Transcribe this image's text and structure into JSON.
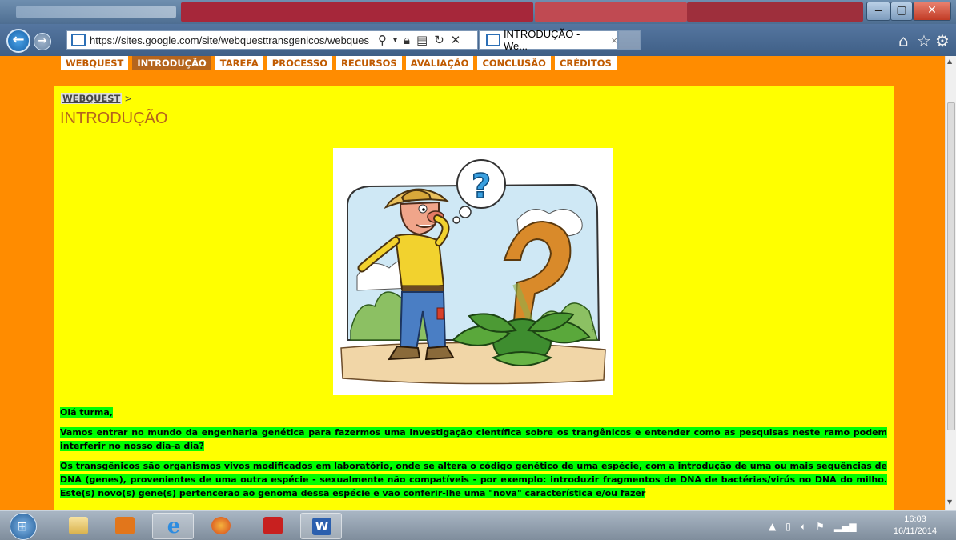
{
  "browser": {
    "url": "https://sites.google.com/site/webquesttransgenicos/webques",
    "tab_title": "INTRODUÇÃO - We...",
    "tab_close": "×"
  },
  "site_nav": {
    "items": [
      {
        "label": "WEBQUEST",
        "active": false
      },
      {
        "label": "INTRODUÇÃO",
        "active": true
      },
      {
        "label": "TAREFA",
        "active": false
      },
      {
        "label": "PROCESSO",
        "active": false
      },
      {
        "label": "RECURSOS",
        "active": false
      },
      {
        "label": "AVALIAÇÃO",
        "active": false
      },
      {
        "label": "CONCLUSÃO",
        "active": false
      },
      {
        "label": "CRÉDITOS",
        "active": false
      }
    ]
  },
  "page": {
    "breadcrumb_link": "WEBQUEST",
    "breadcrumb_sep": ">",
    "title": "INTRODUÇÃO",
    "greeting": "Olá turma,",
    "para1": "Vamos entrar no mundo da engenharia genética para fazermos uma investigação científica sobre os trangênicos e entender como as pesquisas neste ramo podem interferir no nosso dia-a dia?",
    "para2": "Os transgênicos são organismos vivos modificados em laboratório, onde se altera o código genético de uma espécie, com a introdução de uma ou mais sequências de DNA (genes), provenientes de uma outra espécie - sexualmente não compatíveis - por exemplo: introduzir fragmentos de DNA de bactérias/virús no DNA do milho. Este(s) novo(s) gene(s) pertencerão ao genoma dessa espécie e vão conferir-lhe uma \"nova\" característica e/ou fazer"
  },
  "taskbar": {
    "word_label": "W",
    "clock_time": "16:03",
    "clock_date": "16/11/2014"
  },
  "colors": {
    "page_bg": "#ff8c00",
    "content_bg": "#ffff00",
    "highlight": "#00ff00",
    "title": "#b5651d"
  }
}
